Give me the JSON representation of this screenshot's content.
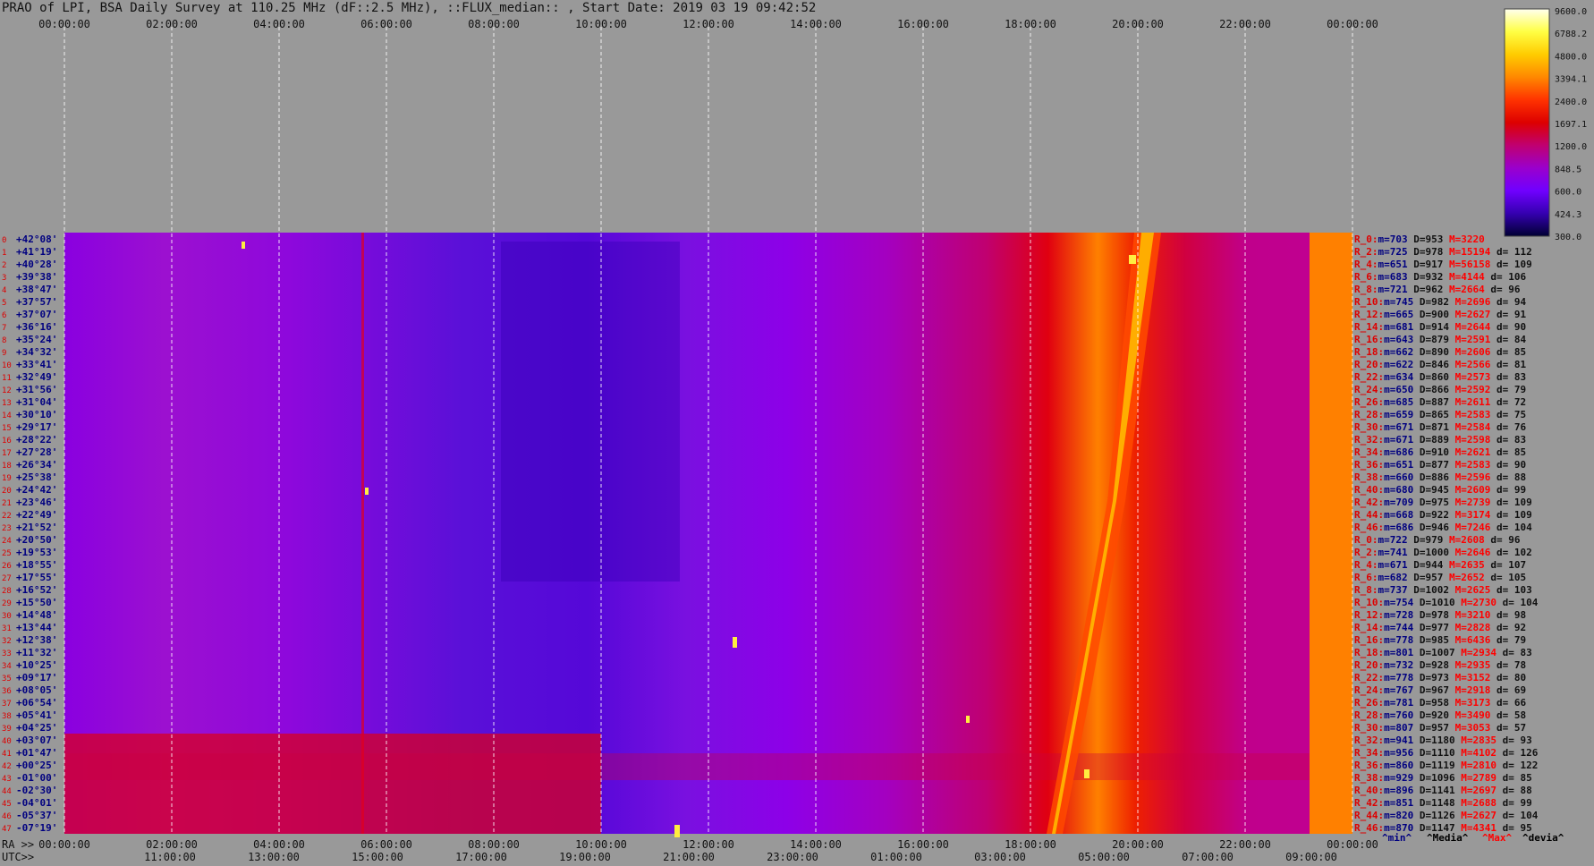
{
  "title": "PRAO of LPI, BSA Daily Survey at 110.25 MHz (dF::2.5 MHz), ::FLUX_median:: , Start Date: 2019 03 19 09:42:52",
  "chart_data": {
    "type": "heatmap",
    "top_axis_labels": [
      "00:00:00",
      "02:00:00",
      "04:00:00",
      "06:00:00",
      "08:00:00",
      "10:00:00",
      "12:00:00",
      "14:00:00",
      "16:00:00",
      "18:00:00",
      "20:00:00",
      "22:00:00",
      "00:00:00"
    ],
    "ra_axis_label": "RA >>",
    "ra_axis_labels": [
      "00:00:00",
      "02:00:00",
      "04:00:00",
      "06:00:00",
      "08:00:00",
      "10:00:00",
      "12:00:00",
      "14:00:00",
      "16:00:00",
      "18:00:00",
      "20:00:00",
      "22:00:00",
      "00:00:00"
    ],
    "utc_axis_label": "UTC>>",
    "utc_axis_labels": [
      "11:00:00",
      "13:00:00",
      "15:00:00",
      "17:00:00",
      "19:00:00",
      "21:00:00",
      "23:00:00",
      "01:00:00",
      "03:00:00",
      "05:00:00",
      "07:00:00",
      "09:00:00"
    ],
    "declinations": [
      "+42°08'",
      "+41°19'",
      "+40°28'",
      "+39°38'",
      "+38°47'",
      "+37°57'",
      "+37°07'",
      "+36°16'",
      "+35°24'",
      "+34°32'",
      "+33°41'",
      "+32°49'",
      "+31°56'",
      "+31°04'",
      "+30°10'",
      "+29°17'",
      "+28°22'",
      "+27°28'",
      "+26°34'",
      "+25°38'",
      "+24°42'",
      "+23°46'",
      "+22°49'",
      "+21°52'",
      "+20°50'",
      "+19°53'",
      "+18°55'",
      "+17°55'",
      "+16°52'",
      "+15°50'",
      "+14°48'",
      "+13°44'",
      "+12°38'",
      "+11°32'",
      "+10°25'",
      "+09°17'",
      "+08°05'",
      "+06°54'",
      "+05°41'",
      "+04°25'",
      "+03°07'",
      "+01°47'",
      "+00°25'",
      "-01°00'",
      "-02°30'",
      "-04°01'",
      "-05°37'",
      "-07°19'"
    ],
    "colorbar": {
      "ticks": [
        "9600.0",
        "6788.2",
        "4800.0",
        "3394.1",
        "2400.0",
        "1697.1",
        "1200.0",
        "848.5",
        "600.0",
        "424.3",
        "300.0"
      ],
      "stops": [
        "#ffffee",
        "#ffff44",
        "#ffcc00",
        "#ff8800",
        "#ff3300",
        "#dd0000",
        "#c00070",
        "#9a00cc",
        "#7000ff",
        "#3500b0",
        "#000033"
      ]
    },
    "row_stats": [
      {
        "r": "R_0:",
        "m": "703",
        "D": "953",
        "M": "3220",
        "d": ""
      },
      {
        "r": "R_2:",
        "m": "725",
        "D": "978",
        "M": "15194",
        "d": "112"
      },
      {
        "r": "R_4:",
        "m": "651",
        "D": "917",
        "M": "56158",
        "d": "109"
      },
      {
        "r": "R_6:",
        "m": "683",
        "D": "932",
        "M": "4144",
        "d": "106"
      },
      {
        "r": "R_8:",
        "m": "721",
        "D": "962",
        "M": "2664",
        "d": "96"
      },
      {
        "r": "R_10:",
        "m": "745",
        "D": "982",
        "M": "2696",
        "d": "94"
      },
      {
        "r": "R_12:",
        "m": "665",
        "D": "900",
        "M": "2627",
        "d": "91"
      },
      {
        "r": "R_14:",
        "m": "681",
        "D": "914",
        "M": "2644",
        "d": "90"
      },
      {
        "r": "R_16:",
        "m": "643",
        "D": "879",
        "M": "2591",
        "d": "84"
      },
      {
        "r": "R_18:",
        "m": "662",
        "D": "890",
        "M": "2606",
        "d": "85"
      },
      {
        "r": "R_20:",
        "m": "622",
        "D": "846",
        "M": "2566",
        "d": "81"
      },
      {
        "r": "R_22:",
        "m": "634",
        "D": "860",
        "M": "2573",
        "d": "83"
      },
      {
        "r": "R_24:",
        "m": "650",
        "D": "866",
        "M": "2592",
        "d": "79"
      },
      {
        "r": "R_26:",
        "m": "685",
        "D": "887",
        "M": "2611",
        "d": "72"
      },
      {
        "r": "R_28:",
        "m": "659",
        "D": "865",
        "M": "2583",
        "d": "75"
      },
      {
        "r": "R_30:",
        "m": "671",
        "D": "871",
        "M": "2584",
        "d": "76"
      },
      {
        "r": "R_32:",
        "m": "671",
        "D": "889",
        "M": "2598",
        "d": "83"
      },
      {
        "r": "R_34:",
        "m": "686",
        "D": "910",
        "M": "2621",
        "d": "85"
      },
      {
        "r": "R_36:",
        "m": "651",
        "D": "877",
        "M": "2583",
        "d": "90"
      },
      {
        "r": "R_38:",
        "m": "660",
        "D": "886",
        "M": "2596",
        "d": "88"
      },
      {
        "r": "R_40:",
        "m": "680",
        "D": "945",
        "M": "2609",
        "d": "99"
      },
      {
        "r": "R_42:",
        "m": "709",
        "D": "975",
        "M": "2739",
        "d": "109"
      },
      {
        "r": "R_44:",
        "m": "668",
        "D": "922",
        "M": "3174",
        "d": "109"
      },
      {
        "r": "R_46:",
        "m": "686",
        "D": "946",
        "M": "7246",
        "d": "104"
      },
      {
        "r": "R_0:",
        "m": "722",
        "D": "979",
        "M": "2608",
        "d": "96"
      },
      {
        "r": "R_2:",
        "m": "741",
        "D": "1000",
        "M": "2646",
        "d": "102"
      },
      {
        "r": "R_4:",
        "m": "671",
        "D": "944",
        "M": "2635",
        "d": "107"
      },
      {
        "r": "R_6:",
        "m": "682",
        "D": "957",
        "M": "2652",
        "d": "105"
      },
      {
        "r": "R_8:",
        "m": "737",
        "D": "1002",
        "M": "2625",
        "d": "103"
      },
      {
        "r": "R_10:",
        "m": "754",
        "D": "1010",
        "M": "2730",
        "d": "104"
      },
      {
        "r": "R_12:",
        "m": "728",
        "D": "978",
        "M": "3210",
        "d": "98"
      },
      {
        "r": "R_14:",
        "m": "744",
        "D": "977",
        "M": "2828",
        "d": "92"
      },
      {
        "r": "R_16:",
        "m": "778",
        "D": "985",
        "M": "6436",
        "d": "79"
      },
      {
        "r": "R_18:",
        "m": "801",
        "D": "1007",
        "M": "2934",
        "d": "83"
      },
      {
        "r": "R_20:",
        "m": "732",
        "D": "928",
        "M": "2935",
        "d": "78"
      },
      {
        "r": "R_22:",
        "m": "778",
        "D": "973",
        "M": "3152",
        "d": "80"
      },
      {
        "r": "R_24:",
        "m": "767",
        "D": "967",
        "M": "2918",
        "d": "69"
      },
      {
        "r": "R_26:",
        "m": "781",
        "D": "958",
        "M": "3173",
        "d": "66"
      },
      {
        "r": "R_28:",
        "m": "760",
        "D": "920",
        "M": "3490",
        "d": "58"
      },
      {
        "r": "R_30:",
        "m": "807",
        "D": "957",
        "M": "3053",
        "d": "57"
      },
      {
        "r": "R_32:",
        "m": "941",
        "D": "1180",
        "M": "2835",
        "d": "93"
      },
      {
        "r": "R_34:",
        "m": "956",
        "D": "1110",
        "M": "4102",
        "d": "126"
      },
      {
        "r": "R_36:",
        "m": "860",
        "D": "1119",
        "M": "2810",
        "d": "122"
      },
      {
        "r": "R_38:",
        "m": "929",
        "D": "1096",
        "M": "2789",
        "d": "85"
      },
      {
        "r": "R_40:",
        "m": "896",
        "D": "1141",
        "M": "2697",
        "d": "88"
      },
      {
        "r": "R_42:",
        "m": "851",
        "D": "1148",
        "M": "2688",
        "d": "99"
      },
      {
        "r": "R_44:",
        "m": "820",
        "D": "1126",
        "M": "2627",
        "d": "104"
      },
      {
        "r": "R_46:",
        "m": "870",
        "D": "1147",
        "M": "4341",
        "d": "95"
      }
    ],
    "stats_legend": [
      "^min^",
      "^Media^",
      "^Max^",
      "^devia^"
    ],
    "stats_legend_colors": [
      "#000080",
      "#000000",
      "#ff0000",
      "#000000"
    ]
  }
}
